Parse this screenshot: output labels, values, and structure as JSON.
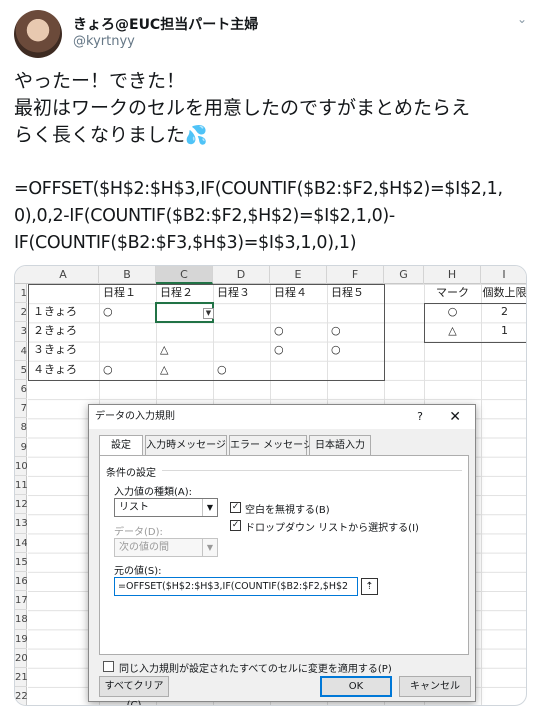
{
  "user": {
    "name": "きょろ@EUC担当パート主婦",
    "handle": "@kyrtnyy"
  },
  "tweet": {
    "lines": [
      "やったー！できた！",
      "最初はワークのセルを用意したのですがまとめたらえ",
      "らく長くなりました"
    ],
    "formula": [
      "=OFFSET($H$2:$H$3,IF(COUNTIF($B2:$F2,$H$2)=$I$2,1,",
      "0),0,2-IF(COUNTIF($B2:$F2,$H$2)=$I$2,1,0)-",
      "IF(COUNTIF($B2:$F3,$H$3)=$I$3,1,0),1)"
    ]
  },
  "sheet": {
    "columns": [
      "A",
      "B",
      "C",
      "D",
      "E",
      "F",
      "G",
      "H",
      "I"
    ],
    "rows": [
      "1",
      "2",
      "3",
      "4",
      "5",
      "6",
      "7",
      "8",
      "9",
      "10",
      "11",
      "12",
      "13",
      "14",
      "15",
      "16",
      "17",
      "18",
      "19",
      "20",
      "21",
      "22"
    ],
    "headers": [
      "日程１",
      "日程２",
      "日程３",
      "日程４",
      "日程５"
    ],
    "names": [
      "１きょろ",
      "２きょろ",
      "３きょろ",
      "４きょろ"
    ],
    "marks": {
      "circle": "○",
      "triangle": "△"
    },
    "side_headers": [
      "マーク",
      "個数上限"
    ],
    "side_values": [
      "2",
      "1"
    ]
  },
  "dialog": {
    "title": "データの入力規則",
    "help": "?",
    "close": "✕",
    "tabs": [
      "設定",
      "入力時メッセージ",
      "エラー メッセージ",
      "日本語入力"
    ],
    "section": "条件の設定",
    "type_label": "入力値の種類(A):",
    "type_value": "リスト",
    "ignore_blank": "空白を無視する(B)",
    "dropdown": "ドロップダウン リストから選択する(I)",
    "data_label": "データ(D):",
    "data_value": "次の値の間",
    "source_label": "元の値(S):",
    "source_value": "=OFFSET($H$2:$H$3,IF(COUNTIF($B2:$F2,$H$2",
    "apply_all": "同じ入力規則が設定されたすべてのセルに変更を適用する(P)",
    "clear": "すべてクリア(C)",
    "ok": "OK",
    "cancel": "キャンセル"
  }
}
